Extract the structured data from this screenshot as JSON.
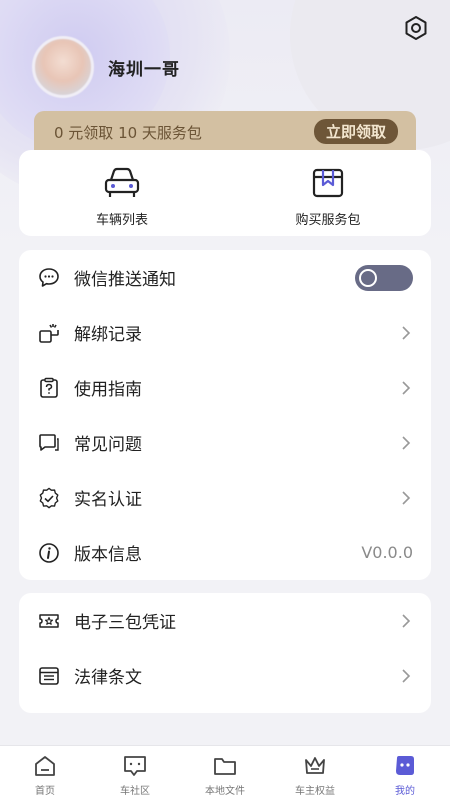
{
  "header": {
    "username": "海圳一哥"
  },
  "promo": {
    "text": "0 元领取 10 天服务包",
    "button": "立即领取"
  },
  "quick_actions": [
    {
      "label": "车辆列表",
      "icon": "car-icon"
    },
    {
      "label": "购买服务包",
      "icon": "service-package-icon"
    }
  ],
  "menu1": [
    {
      "label": "微信推送通知",
      "icon": "chat-bubble-icon",
      "toggle": "off"
    },
    {
      "label": "解绑记录",
      "icon": "unbind-icon"
    },
    {
      "label": "使用指南",
      "icon": "guide-icon"
    },
    {
      "label": "常见问题",
      "icon": "faq-icon"
    },
    {
      "label": "实名认证",
      "icon": "verify-icon"
    },
    {
      "label": "版本信息",
      "icon": "info-icon",
      "value": "V0.0.0"
    }
  ],
  "menu2": [
    {
      "label": "电子三包凭证",
      "icon": "warranty-icon"
    },
    {
      "label": "法律条文",
      "icon": "legal-icon"
    }
  ],
  "tabs": [
    {
      "label": "首页",
      "icon": "home-icon"
    },
    {
      "label": "车社区",
      "icon": "community-icon"
    },
    {
      "label": "本地文件",
      "icon": "folder-icon"
    },
    {
      "label": "车主权益",
      "icon": "crown-icon"
    },
    {
      "label": "我的",
      "icon": "profile-icon",
      "active": true
    }
  ],
  "colors": {
    "accent": "#5b5bd6",
    "promo_bg": "#d3c0a2",
    "promo_button": "#6e5638",
    "toggle": "#686b86"
  }
}
